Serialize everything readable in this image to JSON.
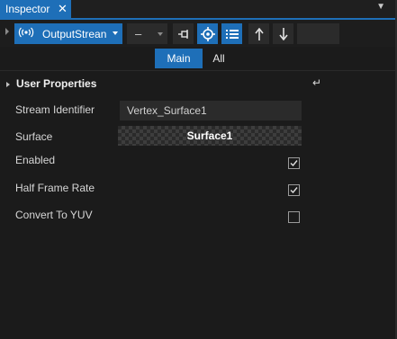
{
  "tab": {
    "title": "Inspector",
    "close_glyph": "✕",
    "menu_glyph": "▼"
  },
  "toolbar": {
    "object_select": {
      "value": "OutputStrean",
      "icon": "broadcast-icon"
    },
    "dash_select": {
      "value": "–"
    },
    "buttons": [
      {
        "name": "pin-icon",
        "active": false
      },
      {
        "name": "target-icon",
        "active": true
      },
      {
        "name": "list-icon",
        "active": true
      },
      {
        "name": "arrow-up-icon",
        "active": false
      },
      {
        "name": "arrow-down-icon",
        "active": false
      }
    ]
  },
  "subtabs": {
    "main": "Main",
    "all": "All"
  },
  "section": {
    "title": "User Properties",
    "reset_glyph": "↵"
  },
  "properties": {
    "stream_identifier": {
      "label": "Stream Identifier",
      "value": "Vertex_Surface1"
    },
    "surface": {
      "label": "Surface",
      "value": "Surface1"
    },
    "enabled": {
      "label": "Enabled",
      "checked": true
    },
    "half_frame_rate": {
      "label": "Half Frame Rate",
      "checked": true
    },
    "convert_to_yuv": {
      "label": "Convert To YUV",
      "checked": false
    }
  },
  "colors": {
    "accent": "#1e6fb8",
    "background": "#1b1b1b",
    "field": "#2b2b2b"
  }
}
